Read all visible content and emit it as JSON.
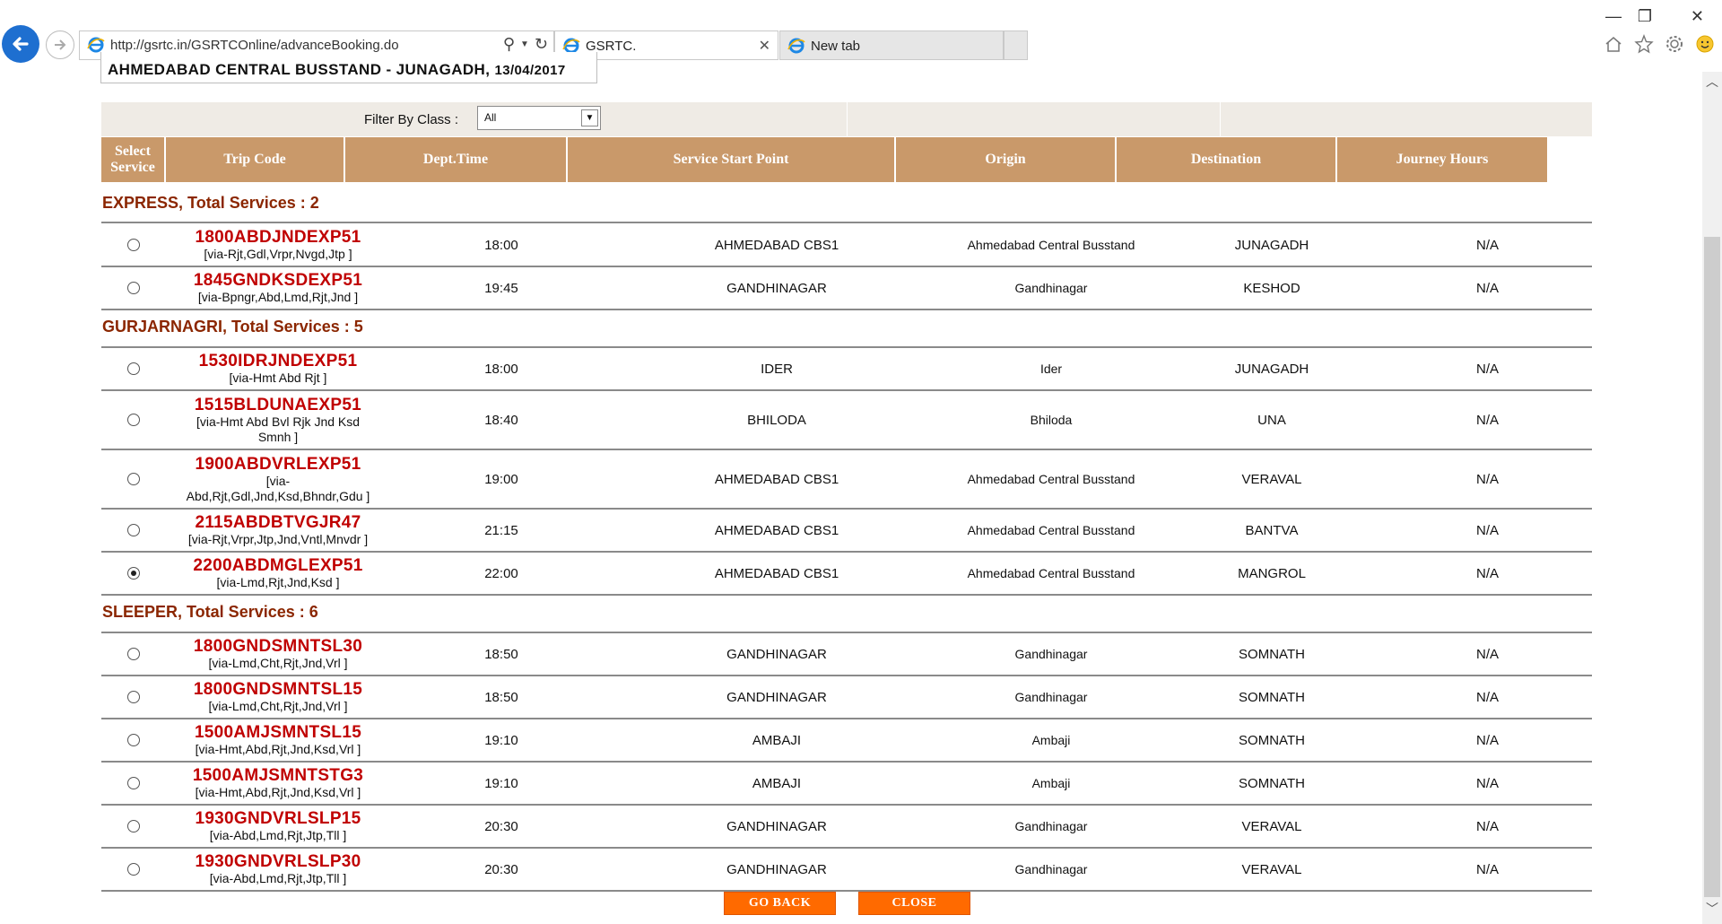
{
  "browser": {
    "url": "http://gsrtc.in/GSRTCOnline/advanceBooking.do",
    "tabs": [
      {
        "label": "GSRTC."
      },
      {
        "label": "New tab"
      }
    ]
  },
  "page": {
    "route": "AHMEDABAD CENTRAL BUSSTAND - JUNAGADH,",
    "date": "13/04/2017",
    "filter": {
      "label": "Filter By Class :",
      "selected": "All"
    },
    "columns": [
      "Select Service",
      "Trip Code",
      "Dept.Time",
      "Service Start Point",
      "Origin",
      "Destination",
      "Journey Hours"
    ],
    "categories": [
      {
        "title": "EXPRESS, Total Services : 2",
        "rows": [
          {
            "code": "1800ABDJNDEXP51",
            "via": "[via-Rjt,Gdl,Vrpr,Nvgd,Jtp ]",
            "time": "18:00",
            "start": "AHMEDABAD CBS1",
            "origin": "Ahmedabad Central Busstand",
            "dest": "JUNAGADH",
            "hours": "N/A",
            "selected": false
          },
          {
            "code": "1845GNDKSDEXP51",
            "via": "[via-Bpngr,Abd,Lmd,Rjt,Jnd ]",
            "time": "19:45",
            "start": "GANDHINAGAR",
            "origin": "Gandhinagar",
            "dest": "KESHOD",
            "hours": "N/A",
            "selected": false
          }
        ]
      },
      {
        "title": "GURJARNAGRI, Total Services : 5",
        "rows": [
          {
            "code": "1530IDRJNDEXP51",
            "via": "[via-Hmt Abd Rjt ]",
            "time": "18:00",
            "start": "IDER",
            "origin": "Ider",
            "dest": "JUNAGADH",
            "hours": "N/A",
            "selected": false
          },
          {
            "code": "1515BLDUNAEXP51",
            "via": "[via-Hmt Abd Bvl Rjk Jnd Ksd Smnh ]",
            "time": "18:40",
            "start": "BHILODA",
            "origin": "Bhiloda",
            "dest": "UNA",
            "hours": "N/A",
            "selected": false
          },
          {
            "code": "1900ABDVRLEXP51",
            "via": "[via-Abd,Rjt,Gdl,Jnd,Ksd,Bhndr,Gdu ]",
            "time": "19:00",
            "start": "AHMEDABAD CBS1",
            "origin": "Ahmedabad Central Busstand",
            "dest": "VERAVAL",
            "hours": "N/A",
            "selected": false
          },
          {
            "code": "2115ABDBTVGJR47",
            "via": "[via-Rjt,Vrpr,Jtp,Jnd,Vntl,Mnvdr ]",
            "time": "21:15",
            "start": "AHMEDABAD CBS1",
            "origin": "Ahmedabad Central Busstand",
            "dest": "BANTVA",
            "hours": "N/A",
            "selected": false
          },
          {
            "code": "2200ABDMGLEXP51",
            "via": "[via-Lmd,Rjt,Jnd,Ksd ]",
            "time": "22:00",
            "start": "AHMEDABAD CBS1",
            "origin": "Ahmedabad Central Busstand",
            "dest": "MANGROL",
            "hours": "N/A",
            "selected": true
          }
        ]
      },
      {
        "title": "SLEEPER, Total Services : 6",
        "rows": [
          {
            "code": "1800GNDSMNTSL30",
            "via": "[via-Lmd,Cht,Rjt,Jnd,Vrl ]",
            "time": "18:50",
            "start": "GANDHINAGAR",
            "origin": "Gandhinagar",
            "dest": "SOMNATH",
            "hours": "N/A",
            "selected": false
          },
          {
            "code": "1800GNDSMNTSL15",
            "via": "[via-Lmd,Cht,Rjt,Jnd,Vrl ]",
            "time": "18:50",
            "start": "GANDHINAGAR",
            "origin": "Gandhinagar",
            "dest": "SOMNATH",
            "hours": "N/A",
            "selected": false
          },
          {
            "code": "1500AMJSMNTSL15",
            "via": "[via-Hmt,Abd,Rjt,Jnd,Ksd,Vrl ]",
            "time": "19:10",
            "start": "AMBAJI",
            "origin": "Ambaji",
            "dest": "SOMNATH",
            "hours": "N/A",
            "selected": false
          },
          {
            "code": "1500AMJSMNTSTG3",
            "via": "[via-Hmt,Abd,Rjt,Jnd,Ksd,Vrl ]",
            "time": "19:10",
            "start": "AMBAJI",
            "origin": "Ambaji",
            "dest": "SOMNATH",
            "hours": "N/A",
            "selected": false
          },
          {
            "code": "1930GNDVRLSLP15",
            "via": "[via-Abd,Lmd,Rjt,Jtp,Tll ]",
            "time": "20:30",
            "start": "GANDHINAGAR",
            "origin": "Gandhinagar",
            "dest": "VERAVAL",
            "hours": "N/A",
            "selected": false
          },
          {
            "code": "1930GNDVRLSLP30",
            "via": "[via-Abd,Lmd,Rjt,Jtp,Tll ]",
            "time": "20:30",
            "start": "GANDHINAGAR",
            "origin": "Gandhinagar",
            "dest": "VERAVAL",
            "hours": "N/A",
            "selected": false
          }
        ]
      }
    ],
    "buttons": {
      "go_back": "GO BACK",
      "close": "CLOSE"
    }
  },
  "colors": {
    "header_bg": "#c9996a",
    "category": "#8b2600",
    "trip_code": "#c00000",
    "button": "#ff6a00"
  }
}
